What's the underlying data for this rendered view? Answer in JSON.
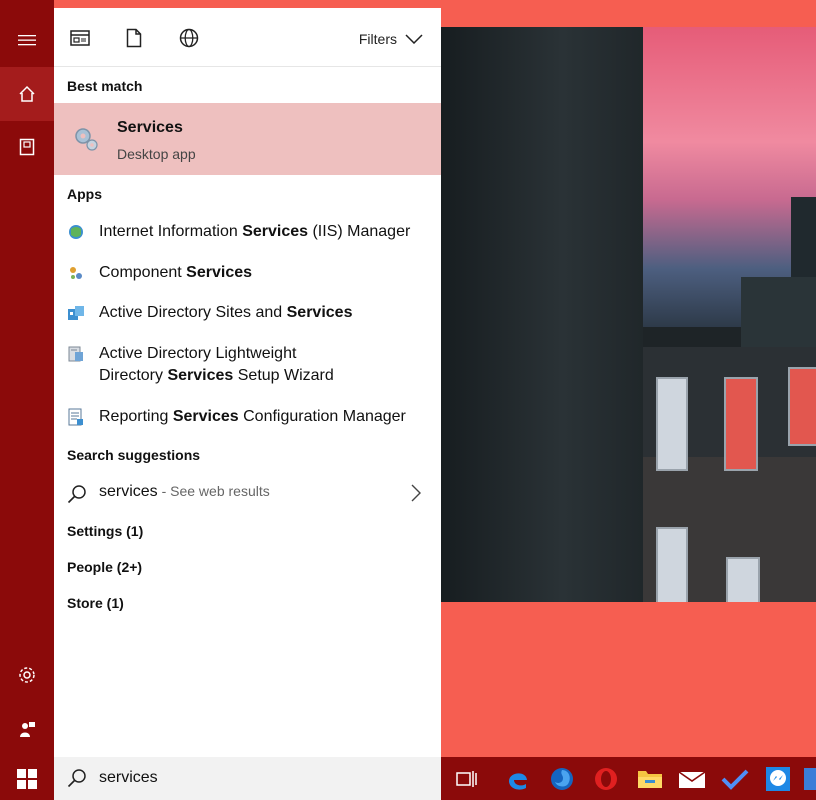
{
  "toolbar": {
    "filters_label": "Filters"
  },
  "best_match": {
    "section_label": "Best match",
    "title": "Services",
    "subtitle": "Desktop app"
  },
  "apps": {
    "section_label": "Apps",
    "items": [
      {
        "pre": "Internet Information ",
        "bold": "Services",
        "post": " (IIS) Manager",
        "icon": "iis-manager-icon"
      },
      {
        "pre": "Component ",
        "bold": "Services",
        "post": "",
        "icon": "component-services-icon"
      },
      {
        "pre": "Active Directory Sites and ",
        "bold": "Services",
        "post": "",
        "icon": "ad-sites-icon"
      },
      {
        "pre": "Active Directory Lightweight",
        "line2_pre": "Directory ",
        "bold": "Services",
        "post": " Setup Wizard",
        "icon": "ad-lds-wizard-icon"
      },
      {
        "pre": "Reporting ",
        "bold": "Services",
        "post": " Configuration Manager",
        "icon": "reporting-services-icon"
      }
    ]
  },
  "search_suggestions": {
    "section_label": "Search suggestions",
    "query": "services",
    "hint": " - See web results"
  },
  "other_sections": {
    "settings": "Settings (1)",
    "people": "People (2+)",
    "store": "Store (1)"
  },
  "search_box": {
    "value": "services"
  },
  "colors": {
    "accent": "#8b0a0a",
    "highlight": "#eec0bf",
    "wallpaper": "#f65e51"
  }
}
